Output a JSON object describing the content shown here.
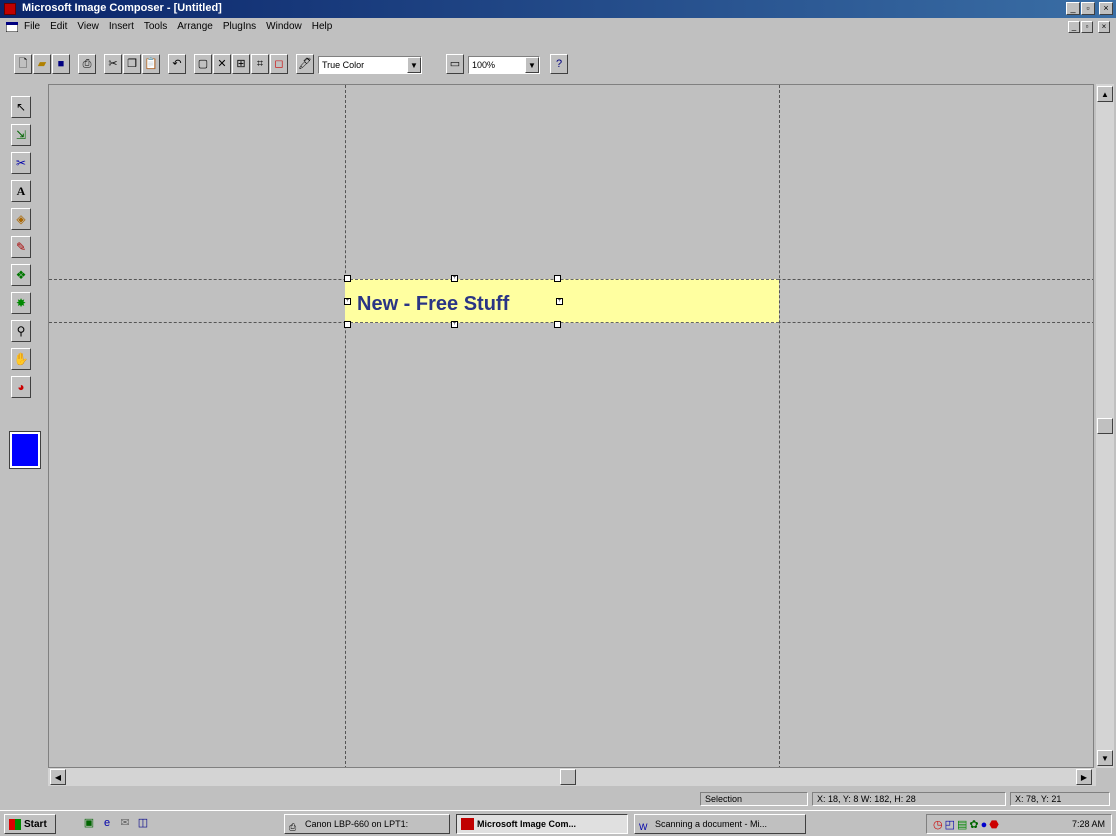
{
  "window": {
    "title": "Microsoft Image Composer - [Untitled]"
  },
  "menu": {
    "items": [
      "File",
      "Edit",
      "View",
      "Insert",
      "Tools",
      "Arrange",
      "PlugIns",
      "Window",
      "Help"
    ]
  },
  "toolbar": {
    "color_format": "True Color",
    "zoom": "100%"
  },
  "toolbox": {
    "tools": [
      "arrow-select-icon",
      "arrange-icon",
      "cutout-icon",
      "text-icon",
      "shapes-icon",
      "paint-icon",
      "effects-icon",
      "texture-transfer-icon",
      "zoom-icon",
      "pan-icon",
      "color-tuning-icon"
    ],
    "current_color": "#0000ff"
  },
  "canvas": {
    "sprite_text": "New - Free Stuff",
    "sprite_color": "#ffffa0",
    "text_color": "#2a3585"
  },
  "status": {
    "mode": "Selection",
    "selection_info": "X: 18, Y: 8 W: 182, H: 28",
    "cursor_pos": "X: 78, Y: 21"
  },
  "taskbar": {
    "start_label": "Start",
    "tasks": [
      {
        "label": "Canon LBP-660 on LPT1:",
        "active": false
      },
      {
        "label": "Microsoft Image Com...",
        "active": true
      },
      {
        "label": "Scanning a document - Mi...",
        "active": false
      }
    ],
    "clock": "7:28 AM"
  }
}
